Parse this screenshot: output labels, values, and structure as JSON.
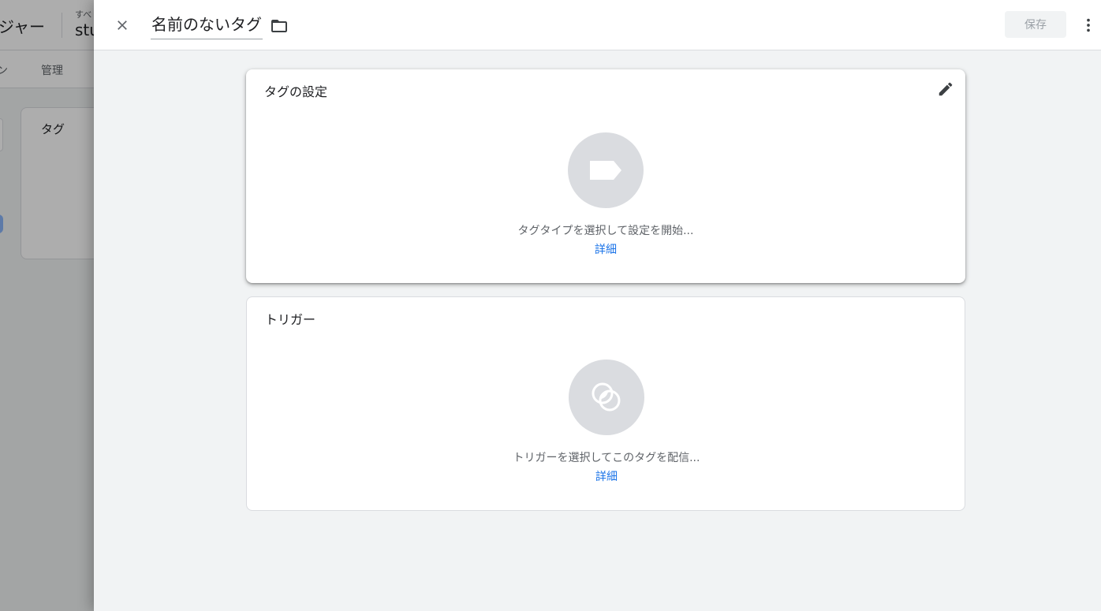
{
  "background": {
    "app_name": "ジャー",
    "account_small": "すべ",
    "account_big": "stu",
    "nav": {
      "item_left": "ン",
      "item_admin": "管理"
    },
    "card_title": "タグ"
  },
  "panel": {
    "tag_name": "名前のないタグ",
    "save_label": "保存",
    "config_card": {
      "title": "タグの設定",
      "hint": "タグタイプを選択して設定を開始...",
      "link": "詳細",
      "icon": "tag-icon"
    },
    "trigger_card": {
      "title": "トリガー",
      "hint": "トリガーを選択してこのタグを配信...",
      "link": "詳細",
      "icon": "trigger-icon"
    }
  },
  "colors": {
    "accent_link": "#1a73e8",
    "placeholder_circle": "#dadce0",
    "panel_bg": "#f1f3f4"
  }
}
